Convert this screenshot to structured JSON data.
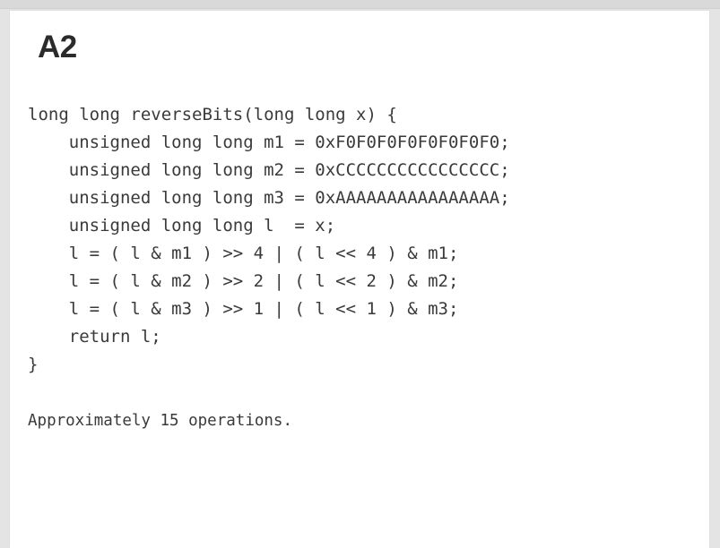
{
  "card": {
    "heading": "A2",
    "code_lines": [
      "long long reverseBits(long long x) {",
      "    unsigned long long m1 = 0xF0F0F0F0F0F0F0F0;",
      "    unsigned long long m2 = 0xCCCCCCCCCCCCCCCC;",
      "    unsigned long long m3 = 0xAAAAAAAAAAAAAAAA;",
      "    unsigned long long l  = x;",
      "    l = ( l & m1 ) >> 4 | ( l << 4 ) & m1;",
      "    l = ( l & m2 ) >> 2 | ( l << 2 ) & m2;",
      "    l = ( l & m3 ) >> 1 | ( l << 1 ) & m3;",
      "    return l;",
      "}"
    ],
    "note": "Approximately 15 operations."
  },
  "colors": {
    "page_background": "#e4e4e4",
    "card_background": "#ffffff",
    "text": "#3a3a3a",
    "heading": "#2b2b2b"
  }
}
